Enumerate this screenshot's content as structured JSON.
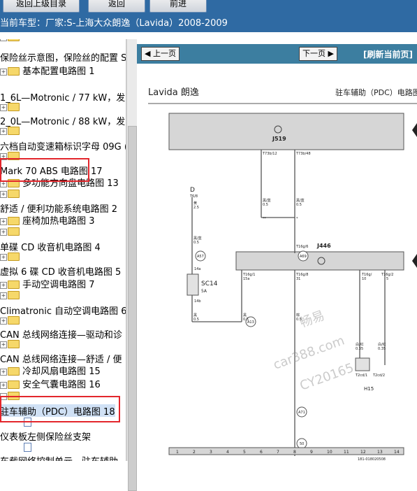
{
  "toolbar": {
    "buttons": [
      "返回上级目录",
      "返回",
      "前进"
    ]
  },
  "vehicle": {
    "label": "当前车型：",
    "value": "厂家:S-上海大众朗逸（Lavida）2008-2009"
  },
  "tree": {
    "items": [
      "保险丝示意图，保险丝的配置 S",
      "基本配置电路图 1",
      "1_6L—Motronic / 77 kW，发",
      "2_0L—Motronic / 88 kW，发",
      "六档自动变速箱标识字母 09G (",
      "Mark 70 ABS 电路图 17",
      "多功能方向盘电路图 13",
      "舒适 / 便利功能系统电路图 2",
      "座椅加热电路图 3",
      "单碟 CD 收音机电路图 4",
      "虚拟 6 碟 CD 收音机电路图 5",
      "手动空调电路图 7",
      "Climatronic 自动空调电路图 6",
      "CAN 总线网络连接—驱动和诊",
      "CAN 总线网络连接—舒适 / 便",
      "冷却风扇电路图 15",
      "安全气囊电路图 16",
      "驻车辅助（PDC）电路图 18",
      "仪表板左侧保险丝支架",
      "车载网络控制单元，驻车辅助"
    ]
  },
  "viewer": {
    "prev": "上一页",
    "next": "下一页",
    "refresh": "[刷新当前页]",
    "doc_title": "Lavida 朗逸",
    "doc_subtitle": "驻车辅助（PDC）电路图",
    "watermark": [
      "畅易",
      "car388.com",
      "CY20165"
    ],
    "diagram": {
      "modules": [
        "J519",
        "J446",
        "SC14",
        "5A",
        "H15"
      ],
      "conn_labels": [
        "T73b/12",
        "T73b/48",
        "T16g/6",
        "T16g/1",
        "T16g/8",
        "T16g/",
        "T16g/2",
        "T16g/1",
        "T16g/",
        "T2cd/1",
        "T2cd/2",
        "T6/8",
        "14a",
        "14b",
        "15a",
        "31",
        "10",
        "5"
      ],
      "wire_labels": [
        "黑/蓝",
        "黑/蓝",
        "黄",
        "黑/蓝",
        "黑",
        "黑",
        "棕",
        "白/红",
        "白/红",
        "白/红",
        "白/红",
        "白/红"
      ],
      "sizes": [
        "0.5",
        "0.5",
        "2.5",
        "0.5",
        "0.5",
        "0.5",
        "0.5",
        "0.5",
        "0.35",
        "0.35",
        "0.35",
        "0.35",
        "0.35",
        "0.35"
      ],
      "ground_points": [
        "A57",
        "A69",
        "A13",
        "A71",
        "50"
      ],
      "fuse_label": "D",
      "star_labels": [
        "**",
        "*"
      ],
      "ruler": [
        "1",
        "2",
        "3",
        "4",
        "5",
        "6",
        "7",
        "8",
        "9",
        "10",
        "11",
        "12",
        "13",
        "14"
      ],
      "footer_code": "181-018020508"
    }
  }
}
